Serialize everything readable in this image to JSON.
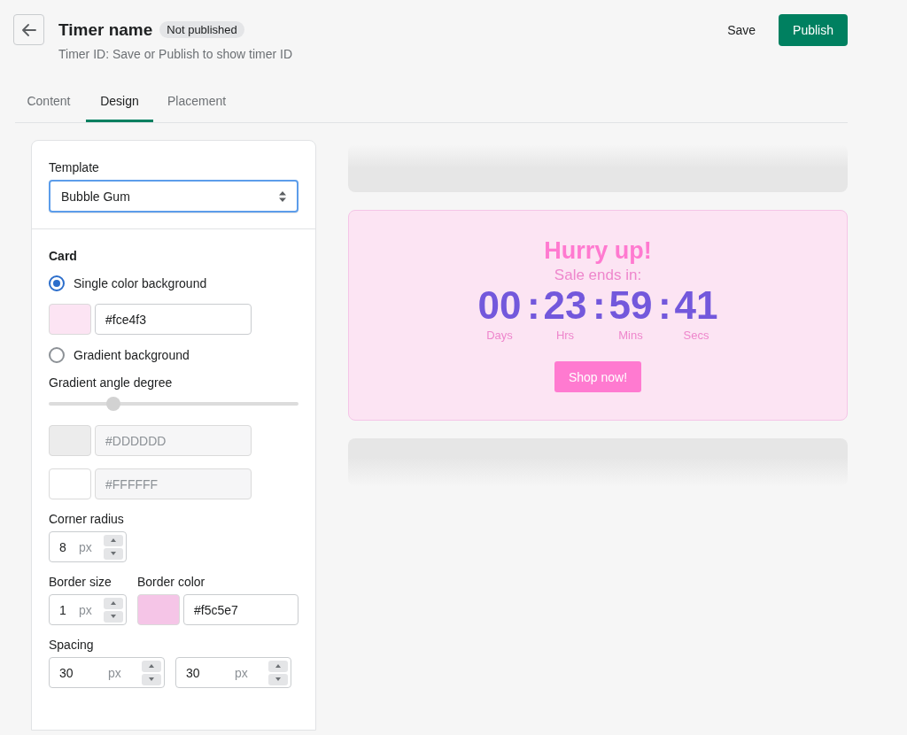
{
  "header": {
    "title": "Timer name",
    "badge": "Not published",
    "subtitle": "Timer ID: Save or Publish to show timer ID",
    "actions": [
      {
        "label": "Save",
        "kind": "plain"
      },
      {
        "label": "Publish",
        "kind": "primary"
      }
    ]
  },
  "tabs": [
    {
      "label": "Content",
      "selected": false
    },
    {
      "label": "Design",
      "selected": true
    },
    {
      "label": "Placement",
      "selected": false
    }
  ],
  "settings": {
    "template": {
      "label": "Template",
      "value": "Bubble Gum"
    },
    "heading": "Card",
    "rows": [
      {
        "kind": "radio",
        "label": "Single color background",
        "selected": true
      },
      {
        "kind": "fields",
        "fields": [
          {
            "kind": "color",
            "color": "#fce4f3",
            "value": "#fce4f3"
          }
        ]
      },
      {
        "kind": "radio",
        "label": "Gradient background",
        "selected": false
      },
      {
        "kind": "slider",
        "label": "Gradient angle degree",
        "level": 0.26
      },
      {
        "kind": "fields",
        "fields": [
          {
            "kind": "color",
            "color": "#ececec",
            "placeholder": "#DDDDDD",
            "disabled": true
          }
        ]
      },
      {
        "kind": "fields",
        "fields": [
          {
            "kind": "color",
            "color": "#ffffff",
            "placeholder": "#FFFFFF",
            "disabled": true
          }
        ]
      },
      {
        "kind": "fields",
        "fields": [
          {
            "kind": "number",
            "label": "Corner radius",
            "value": "8",
            "unit": "px"
          }
        ]
      },
      {
        "kind": "fields",
        "fields": [
          {
            "kind": "number",
            "label": "Border size",
            "value": "1",
            "unit": "px"
          },
          {
            "kind": "color",
            "label": "Border color",
            "color": "#f5c5e7",
            "value": "#f5c5e7"
          }
        ]
      },
      {
        "kind": "fields",
        "fields": [
          {
            "kind": "number",
            "label": "Spacing",
            "value": "30",
            "unit": "px"
          },
          {
            "kind": "number",
            "value": "30",
            "unit": "px"
          }
        ]
      }
    ]
  },
  "preview": {
    "heading": "Hurry up!",
    "subheading": "Sale ends in:",
    "separator": ":",
    "units": [
      {
        "value": "00",
        "label": "Days"
      },
      {
        "value": "23",
        "label": "Hrs"
      },
      {
        "value": "59",
        "label": "Mins"
      },
      {
        "value": "41",
        "label": "Secs"
      }
    ],
    "button": "Shop now!"
  }
}
